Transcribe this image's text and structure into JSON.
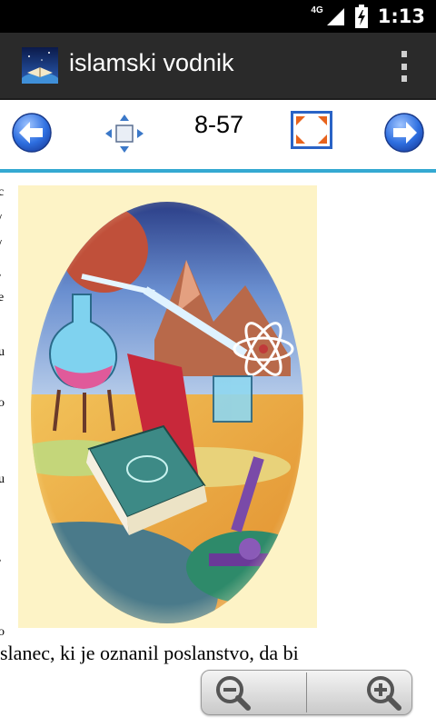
{
  "status_bar": {
    "network": "4G",
    "time": "1:13",
    "icons": [
      "signal-icon",
      "battery-charging-icon"
    ]
  },
  "action_bar": {
    "title": "islamski vodnik",
    "icons": [
      "app-logo-icon",
      "overflow-menu-icon"
    ]
  },
  "toolbar": {
    "page_indicator": "8-57",
    "icons": [
      "back-arrow-icon",
      "move-icon",
      "fullscreen-icon",
      "forward-arrow-icon"
    ],
    "accent_color": "#34a9d2"
  },
  "page": {
    "illustration": "book-and-laboratory-illustration",
    "text_line": "slanec, ki je oznanil poslanstvo, da bi",
    "margin_chars": [
      "c",
      "/",
      "/",
      ",",
      "e",
      "",
      "u",
      "",
      "o",
      "",
      "u",
      "",
      ",",
      "",
      "o"
    ]
  },
  "zoom": {
    "icons": [
      "zoom-out-icon",
      "zoom-in-icon"
    ]
  }
}
